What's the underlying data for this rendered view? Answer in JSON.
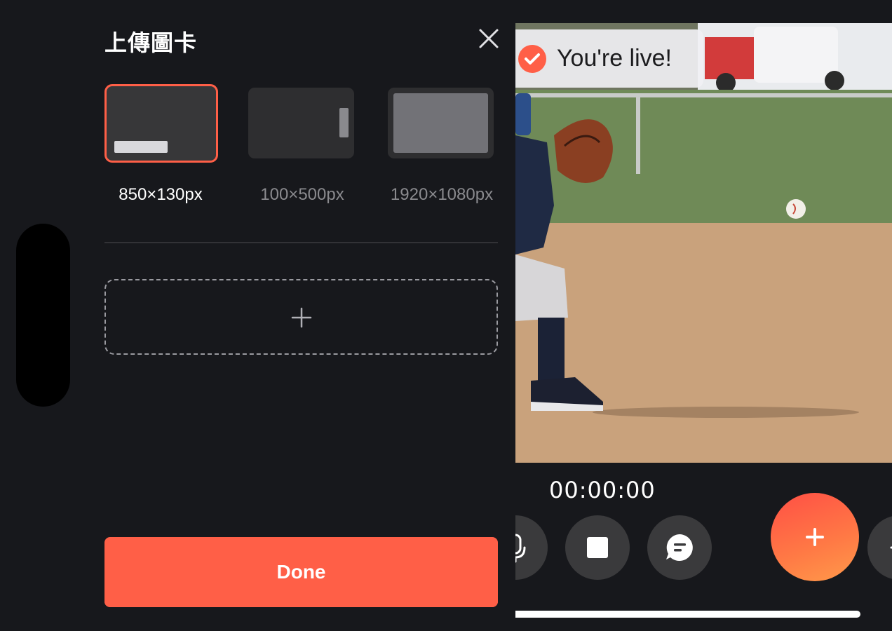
{
  "panel": {
    "title": "上傳圖卡",
    "size_options": [
      {
        "label": "850×130px",
        "selected": true
      },
      {
        "label": "100×500px",
        "selected": false
      },
      {
        "label": "1920×1080px",
        "selected": false
      }
    ],
    "done_label": "Done"
  },
  "live": {
    "toast_text": "You're live!",
    "timer": "00:00:00"
  },
  "colors": {
    "accent": "#ff5f47",
    "background": "#17181c",
    "control_button": "#3a3a3c"
  },
  "icons": {
    "close": "close-icon",
    "add": "plus-icon",
    "toast": "check-icon",
    "mic": "microphone-icon",
    "stop": "stop-icon",
    "chat": "chat-icon",
    "fab": "plus-icon"
  }
}
